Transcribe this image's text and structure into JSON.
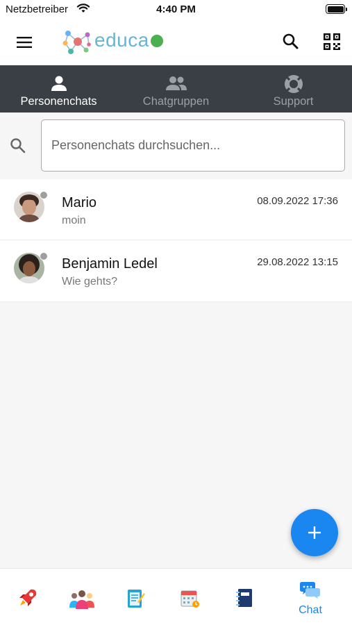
{
  "statusbar": {
    "carrier": "Netzbetreiber",
    "time": "4:40 PM"
  },
  "appbar": {
    "brand": "educa",
    "icons": {
      "menu": "hamburger-icon",
      "logo": "network-logo",
      "search": "search-icon",
      "qr": "qr-code-icon"
    },
    "accent_color": "#64b5d6",
    "online_color": "#4caf50"
  },
  "tabs": [
    {
      "label": "Personenchats",
      "icon": "person-icon",
      "active": true
    },
    {
      "label": "Chatgruppen",
      "icon": "group-icon",
      "active": false
    },
    {
      "label": "Support",
      "icon": "lifebuoy-icon",
      "active": false
    }
  ],
  "search": {
    "placeholder": "Personenchats durchsuchen..."
  },
  "chats": [
    {
      "name": "Mario",
      "preview": "moin",
      "timestamp": "08.09.2022 17:36"
    },
    {
      "name": "Benjamin Ledel",
      "preview": "Wie gehts?",
      "timestamp": "29.08.2022 13:15"
    }
  ],
  "fab": {
    "icon": "plus-icon",
    "color": "#1a86f0"
  },
  "bottom_nav": {
    "items": [
      {
        "icon": "rocket-icon"
      },
      {
        "icon": "people-icon"
      },
      {
        "icon": "task-list-icon"
      },
      {
        "icon": "calendar-icon"
      },
      {
        "icon": "notebook-icon"
      }
    ],
    "chat_label": "Chat",
    "active_color": "#1a86f0"
  }
}
